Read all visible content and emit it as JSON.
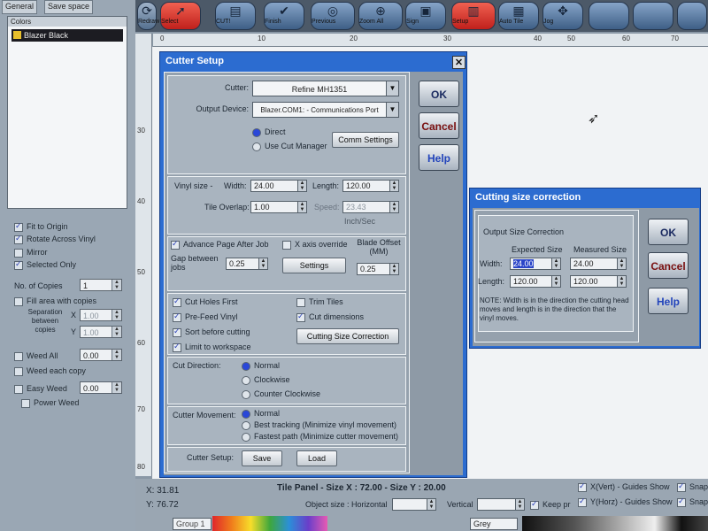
{
  "left_panel": {
    "tabs": [
      "General",
      "Save space"
    ],
    "colors_header": "Colors",
    "color_item": "Blazer Black",
    "options": [
      {
        "label": "Fit to Origin",
        "checked": true
      },
      {
        "label": "Rotate Across Vinyl",
        "checked": true
      },
      {
        "label": "Mirror",
        "checked": false
      },
      {
        "label": "Selected Only",
        "checked": true
      }
    ],
    "copies_label": "No. of Copies",
    "copies_value": "1",
    "fill_label": "Fill area with copies",
    "separation_label": "Separation between copies",
    "sep_x_label": "X",
    "sep_x_value": "1.00",
    "sep_y_label": "Y",
    "sep_y_value": "1.00",
    "weed_all_label": "Weed All",
    "weed_all_value": "0.00",
    "weed_each_label": "Weed each copy",
    "easy_weed_label": "Easy Weed",
    "easy_weed_value": "0.00",
    "power_weed_label": "Power Weed"
  },
  "toolbar": {
    "buttons": [
      {
        "label": "Redraw",
        "icon": "redraw-icon"
      },
      {
        "label": "Select",
        "icon": "select-icon"
      },
      {
        "label": "CUT!",
        "icon": "cutter-icon"
      },
      {
        "label": "Finish",
        "icon": "finish-icon"
      },
      {
        "label": "Previous",
        "icon": "previous-icon"
      },
      {
        "label": "Zoom All",
        "icon": "zoom-icon"
      },
      {
        "label": "Sign",
        "icon": "sign-icon"
      },
      {
        "label": "Setup",
        "icon": "setup-icon"
      },
      {
        "label": "Auto Tile",
        "icon": "autotile-icon"
      },
      {
        "label": "Jog",
        "icon": "jog-icon"
      }
    ]
  },
  "ruler": {
    "h_ticks": [
      "0",
      "10",
      "20",
      "30",
      "40",
      "50",
      "60",
      "70"
    ],
    "v_ticks": [
      "30",
      "40",
      "50",
      "60",
      "70",
      "80"
    ]
  },
  "cutter_setup": {
    "title": "Cutter Setup",
    "cutter_label": "Cutter:",
    "cutter_value": "Refine MH1351",
    "output_label": "Output Device:",
    "output_value": "Blazer.COM1: - Communications Port",
    "direct_label": "Direct",
    "use_cut_manager_label": "Use Cut Manager",
    "comm_settings_label": "Comm Settings",
    "vinyl_size_label": "Vinyl size -",
    "width_label": "Width:",
    "width_value": "24.00",
    "length_label": "Length:",
    "length_value": "120.00",
    "tile_overlap_label": "Tile Overlap:",
    "tile_overlap_value": "1.00",
    "speed_label": "Speed:",
    "speed_value": "23.43",
    "speed_unit": "Inch/Sec",
    "advance_page_label": "Advance Page After Job",
    "gap_label": "Gap between jobs",
    "gap_value": "0.25",
    "x_axis_override_label": "X axis override",
    "settings_label": "Settings",
    "blade_offset_label": "Blade Offset (MM)",
    "blade_offset_value": "0.25",
    "cut_holes_first_label": "Cut Holes First",
    "pre_feed_label": "Pre-Feed Vinyl",
    "sort_before_label": "Sort before cutting",
    "limit_workspace_label": "Limit to workspace",
    "trim_tiles_label": "Trim Tiles",
    "cut_dimensions_label": "Cut dimensions",
    "cutting_size_correction_label": "Cutting Size Correction",
    "cut_direction_label": "Cut Direction:",
    "dir_normal_label": "Normal",
    "dir_clockwise_label": "Clockwise",
    "dir_counter_label": "Counter Clockwise",
    "cutter_movement_label": "Cutter Movement:",
    "mov_normal_label": "Normal",
    "mov_best_label": "Best tracking (Minimize vinyl movement)",
    "mov_fastest_label": "Fastest path (Minimize cutter movement)",
    "cutter_setup_label": "Cutter Setup:",
    "save_label": "Save",
    "load_label": "Load",
    "ok_label": "OK",
    "cancel_label": "Cancel",
    "help_label": "Help"
  },
  "size_correction": {
    "title": "Cutting size correction",
    "group_label": "Output Size Correction",
    "expected_header": "Expected Size",
    "measured_header": "Measured Size",
    "width_label": "Width:",
    "length_label": "Length:",
    "expected_width": "24.00",
    "expected_length": "120.00",
    "measured_width": "24.00",
    "measured_length": "120.00",
    "note": "NOTE: Width is in the direction the cutting head moves and length is in the direction that the vinyl moves.",
    "ok_label": "OK",
    "cancel_label": "Cancel",
    "help_label": "Help"
  },
  "status": {
    "x_label": "X:",
    "x_value": "31.81",
    "y_label": "Y:",
    "y_value": "76.72",
    "tile_panel_text": "Tile Panel - Size X : 72.00 - Size Y : 20.00",
    "object_size_label": "Object size : Horizontal",
    "vertical_label": "Vertical",
    "keep_prop_label": "Keep pr",
    "guides_x_label": "X(Vert) - Guides Show",
    "guides_y_label": "Y(Horz) - Guides Show",
    "snap_label": "Snap",
    "grey_label": "Grey",
    "group_label": "Group 1"
  },
  "colors": {
    "dialog_title_bg": "#2c6cd0",
    "panel_bg": "#8e9aa6",
    "selected_field": "#2a45c8"
  }
}
